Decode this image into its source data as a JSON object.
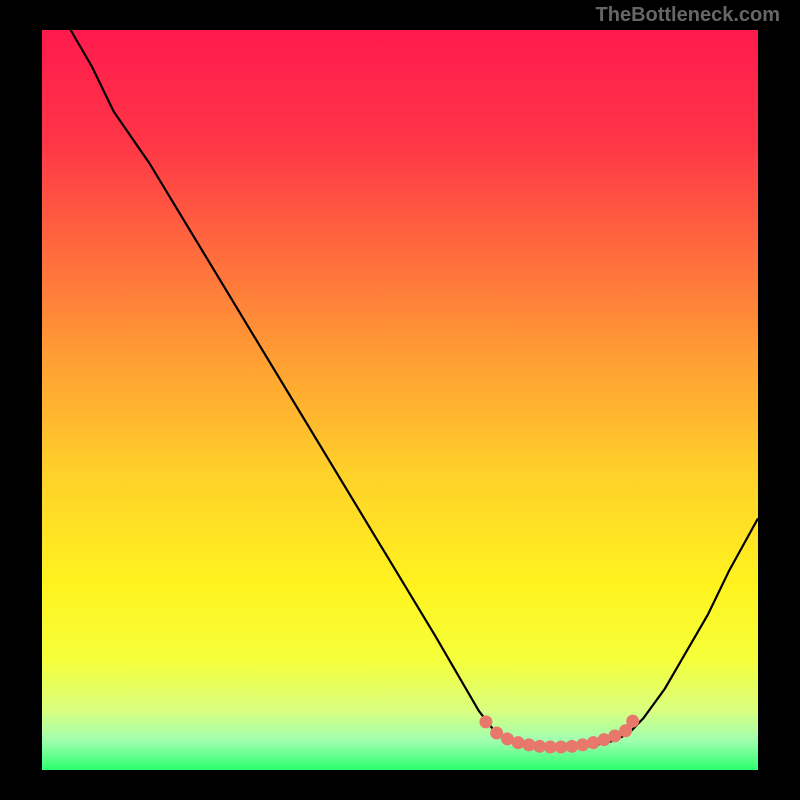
{
  "attribution": "TheBottleneck.com",
  "chart_data": {
    "type": "line",
    "title": "",
    "xlabel": "",
    "ylabel": "",
    "xlim": [
      0,
      100
    ],
    "ylim": [
      0,
      100
    ],
    "gradient_bg": {
      "stops": [
        {
          "pos": 0,
          "color": "#ff1a4d"
        },
        {
          "pos": 15,
          "color": "#ff3547"
        },
        {
          "pos": 30,
          "color": "#ff6b3d"
        },
        {
          "pos": 45,
          "color": "#ffa033"
        },
        {
          "pos": 60,
          "color": "#ffd129"
        },
        {
          "pos": 75,
          "color": "#fff31f"
        },
        {
          "pos": 85,
          "color": "#f5ff3a"
        },
        {
          "pos": 92,
          "color": "#d9ff80"
        },
        {
          "pos": 96,
          "color": "#a0ffb0"
        },
        {
          "pos": 100,
          "color": "#2bff6e"
        }
      ]
    },
    "curve": [
      {
        "x": 4,
        "y": 100
      },
      {
        "x": 7,
        "y": 95
      },
      {
        "x": 10,
        "y": 89
      },
      {
        "x": 15,
        "y": 82
      },
      {
        "x": 20,
        "y": 74
      },
      {
        "x": 25,
        "y": 66
      },
      {
        "x": 30,
        "y": 58
      },
      {
        "x": 35,
        "y": 50
      },
      {
        "x": 40,
        "y": 42
      },
      {
        "x": 45,
        "y": 34
      },
      {
        "x": 50,
        "y": 26
      },
      {
        "x": 55,
        "y": 18
      },
      {
        "x": 58,
        "y": 13
      },
      {
        "x": 61,
        "y": 8
      },
      {
        "x": 63,
        "y": 5.5
      },
      {
        "x": 65,
        "y": 4
      },
      {
        "x": 68,
        "y": 3.3
      },
      {
        "x": 71,
        "y": 3
      },
      {
        "x": 74,
        "y": 3
      },
      {
        "x": 77,
        "y": 3.3
      },
      {
        "x": 80,
        "y": 4
      },
      {
        "x": 82,
        "y": 5
      },
      {
        "x": 84,
        "y": 7
      },
      {
        "x": 87,
        "y": 11
      },
      {
        "x": 90,
        "y": 16
      },
      {
        "x": 93,
        "y": 21
      },
      {
        "x": 96,
        "y": 27
      },
      {
        "x": 100,
        "y": 34
      }
    ],
    "markers": [
      {
        "x": 62,
        "y": 6.5
      },
      {
        "x": 63.5,
        "y": 5
      },
      {
        "x": 65,
        "y": 4.2
      },
      {
        "x": 66.5,
        "y": 3.7
      },
      {
        "x": 68,
        "y": 3.4
      },
      {
        "x": 69.5,
        "y": 3.2
      },
      {
        "x": 71,
        "y": 3.1
      },
      {
        "x": 72.5,
        "y": 3.1
      },
      {
        "x": 74,
        "y": 3.2
      },
      {
        "x": 75.5,
        "y": 3.4
      },
      {
        "x": 77,
        "y": 3.7
      },
      {
        "x": 78.5,
        "y": 4.1
      },
      {
        "x": 80,
        "y": 4.6
      },
      {
        "x": 81.5,
        "y": 5.3
      },
      {
        "x": 82.5,
        "y": 6.6
      }
    ],
    "marker_color": "#e8786a",
    "curve_color": "#000000"
  }
}
